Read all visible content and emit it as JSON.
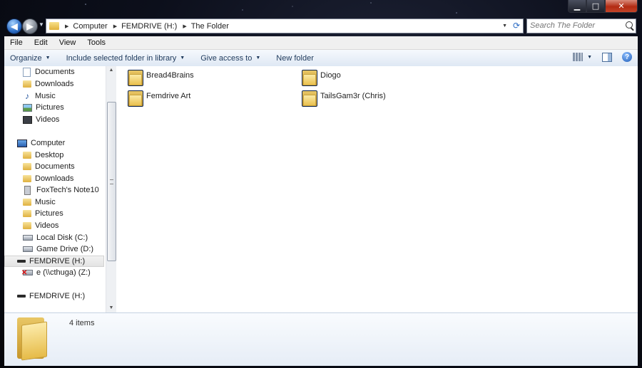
{
  "window": {
    "controls": {
      "minimize": "▁",
      "maximize": "□",
      "close": "✕"
    }
  },
  "address": {
    "breadcrumbs": [
      "Computer",
      "FEMDRIVE (H:)",
      "The Folder"
    ],
    "search_placeholder": "Search The Folder"
  },
  "menu": [
    "File",
    "Edit",
    "View",
    "Tools"
  ],
  "commands": {
    "organize": "Organize",
    "include": "Include selected folder in library",
    "give_access": "Give access to",
    "new_folder": "New folder",
    "help": "?"
  },
  "nav": {
    "items": [
      {
        "label": "Documents",
        "icon": "document-icon"
      },
      {
        "label": "Downloads",
        "icon": "downloads-folder-icon"
      },
      {
        "label": "Music",
        "icon": "music-icon"
      },
      {
        "label": "Pictures",
        "icon": "pictures-icon"
      },
      {
        "label": "Videos",
        "icon": "videos-icon"
      },
      {
        "label": "Computer",
        "icon": "computer-icon"
      },
      {
        "label": "Desktop",
        "icon": "folder-icon"
      },
      {
        "label": "Documents",
        "icon": "folder-icon"
      },
      {
        "label": "Downloads",
        "icon": "folder-icon"
      },
      {
        "label": "FoxTech's Note10",
        "icon": "phone-icon"
      },
      {
        "label": "Music",
        "icon": "folder-icon"
      },
      {
        "label": "Pictures",
        "icon": "folder-icon"
      },
      {
        "label": "Videos",
        "icon": "folder-icon"
      },
      {
        "label": "Local Disk (C:)",
        "icon": "hard-drive-icon"
      },
      {
        "label": "Game Drive (D:)",
        "icon": "hard-drive-icon"
      },
      {
        "label": "FEMDRIVE (H:)",
        "icon": "usb-drive-icon",
        "selected": true
      },
      {
        "label": "e (\\\\cthuga) (Z:)",
        "icon": "network-drive-disconnected-icon"
      },
      {
        "label": "FEMDRIVE (H:)",
        "icon": "usb-drive-icon"
      }
    ]
  },
  "files": [
    {
      "name": "Bread4Brains"
    },
    {
      "name": "Diogo"
    },
    {
      "name": "Femdrive Art"
    },
    {
      "name": "TailsGam3r (Chris)"
    }
  ],
  "details": {
    "count": "4 items"
  }
}
